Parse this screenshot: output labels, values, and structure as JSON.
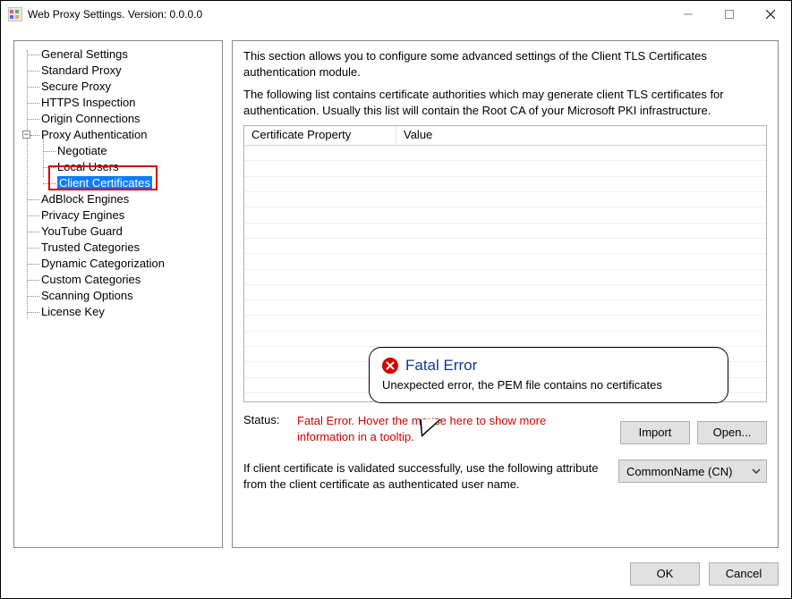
{
  "window": {
    "title": "Web Proxy Settings. Version: 0.0.0.0",
    "minimize": "Minimize",
    "maximize": "Maximize",
    "close": "Close"
  },
  "tree": {
    "items": [
      "General Settings",
      "Standard Proxy",
      "Secure Proxy",
      "HTTPS Inspection",
      "Origin Connections",
      "Proxy Authentication",
      "AdBlock Engines",
      "Privacy Engines",
      "YouTube Guard",
      "Trusted Categories",
      "Dynamic Categorization",
      "Custom Categories",
      "Scanning Options",
      "License Key"
    ],
    "proxy_auth_children": [
      "Negotiate",
      "Local Users",
      "Client Certificates"
    ],
    "selected": "Client Certificates"
  },
  "content": {
    "desc1": "This section allows you to configure some advanced settings of the Client TLS Certificates authentication module.",
    "desc2": "The following list contains certificate authorities which may generate client TLS certificates for authentication. Usually this list will contain the Root CA of your Microsoft PKI infrastructure.",
    "columns": {
      "c1": "Certificate Property",
      "c2": "Value"
    },
    "status_label": "Status:",
    "status_text": "Fatal Error. Hover the mouse here to show more information in a tooltip.",
    "import_btn": "Import",
    "open_btn": "Open...",
    "attr_text": "If client certificate is validated successfully, use the following attribute from the client certificate as authenticated user name.",
    "combo_value": "CommonName (CN)"
  },
  "tooltip": {
    "title": "Fatal Error",
    "body": "Unexpected error, the PEM file contains no certificates"
  },
  "footer": {
    "ok": "OK",
    "cancel": "Cancel"
  }
}
